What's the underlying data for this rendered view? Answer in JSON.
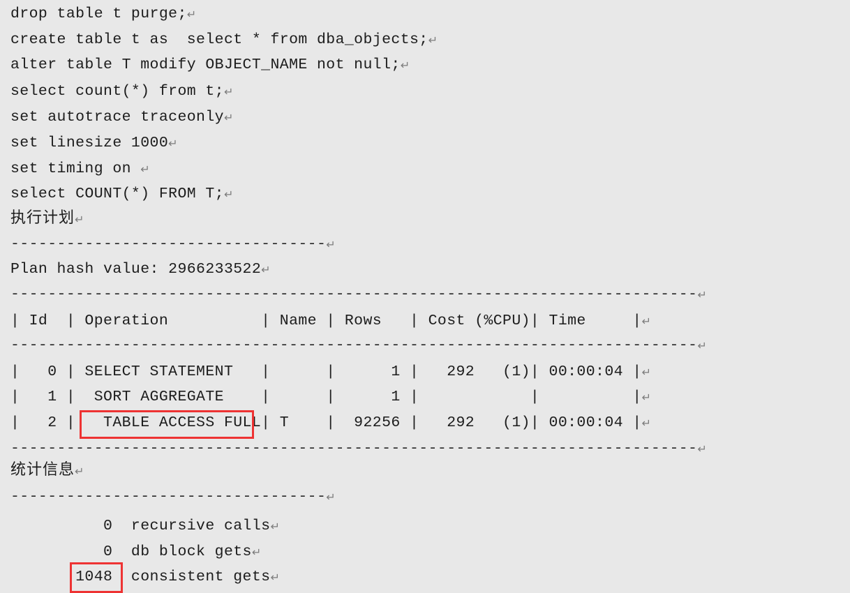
{
  "document": {
    "type": "oracle-sqlplus-transcript",
    "background_color": "#e8e8e8",
    "text_color": "#1c1c1c",
    "highlight_color": "#ee3333",
    "paragraph_mark": "↵"
  },
  "sql_commands": [
    "drop table t purge;",
    "create table t as  select * from dba_objects;",
    "alter table T modify OBJECT_NAME not null;",
    "select count(*) from t;",
    "set autotrace traceonly",
    "set linesize 1000",
    "set timing on ",
    "select COUNT(*) FROM T;"
  ],
  "plan_section": {
    "heading": "执行计划",
    "heading_rule": "----------------------------------",
    "plan_hash_label": "Plan hash value: 2966233522",
    "top_rule": "--------------------------------------------------------------------------",
    "header_row": "| Id  | Operation\t   | Name | Rows   | Cost (%CPU)| Time     |",
    "header_columns": [
      "Id",
      "Operation",
      "Name",
      "Rows",
      "Cost (%CPU)",
      "Time"
    ],
    "mid_rule": "--------------------------------------------------------------------------",
    "rows": [
      {
        "id": "0",
        "operation": "SELECT STATEMENT",
        "name": "",
        "rows": "1",
        "cost": "292",
        "cpu": "(1)",
        "time": "00:00:04",
        "highlighted": false
      },
      {
        "id": "1",
        "operation": "SORT AGGREGATE",
        "name": "",
        "rows": "1",
        "cost": "",
        "cpu": "",
        "time": "",
        "highlighted": false
      },
      {
        "id": "2",
        "operation": "TABLE ACCESS FULL",
        "name": "T",
        "rows": "92256",
        "cost": "292",
        "cpu": "(1)",
        "time": "00:00:04",
        "highlighted": true
      }
    ],
    "bottom_rule": "--------------------------------------------------------------------------"
  },
  "statistics_section": {
    "heading": "统计信息",
    "heading_rule": "----------------------------------",
    "entries": [
      {
        "value": "0",
        "label": "recursive calls",
        "highlighted": false
      },
      {
        "value": "0",
        "label": "db block gets",
        "highlighted": false
      },
      {
        "value": "1048",
        "label": "consistent gets",
        "highlighted": true
      }
    ]
  },
  "rendered_lines": {
    "l01": "drop table t purge;",
    "l02": "create table t as  select * from dba_objects;",
    "l03": "alter table T modify OBJECT_NAME not null;",
    "l04": "select count(*) from t;",
    "l05": "set autotrace traceonly",
    "l06": "set linesize 1000",
    "l07": "set timing on ",
    "l08": "select COUNT(*) FROM T;",
    "l09": "执行计划",
    "l10": "----------------------------------",
    "l11": "Plan hash value: 2966233522",
    "l12": "--------------------------------------------------------------------------",
    "l13": "| Id  | Operation          | Name | Rows   | Cost (%CPU)| Time     |",
    "l14": "--------------------------------------------------------------------------",
    "l15": "|   0 | SELECT STATEMENT   |      |      1 |   292   (1)| 00:00:04 |",
    "l16": "|   1 |  SORT AGGREGATE    |      |      1 |            |          |",
    "l17": "|   2 |   TABLE ACCESS FULL| T    |  92256 |   292   (1)| 00:00:04 |",
    "l18": "--------------------------------------------------------------------------",
    "l19": "统计信息",
    "l20": "----------------------------------",
    "l21": "          0  recursive calls",
    "l22": "          0  db block gets",
    "l23": "       1048  consistent gets"
  }
}
